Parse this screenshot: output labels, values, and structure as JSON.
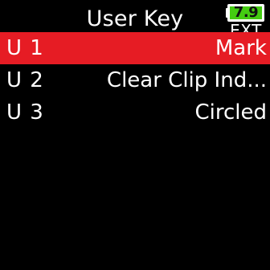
{
  "header": {
    "title": "User Key",
    "battery_level": "7.9",
    "power_source": "EXT",
    "battery_color": "#44cc11"
  },
  "user_keys": [
    {
      "key": "U 1",
      "value": "Mark",
      "selected": true
    },
    {
      "key": "U 2",
      "value": "Clear Clip Ind...",
      "selected": false
    },
    {
      "key": "U 3",
      "value": "Circled",
      "selected": false
    }
  ],
  "colors": {
    "background": "#000000",
    "selection": "#e61c24",
    "text": "#ffffff"
  }
}
